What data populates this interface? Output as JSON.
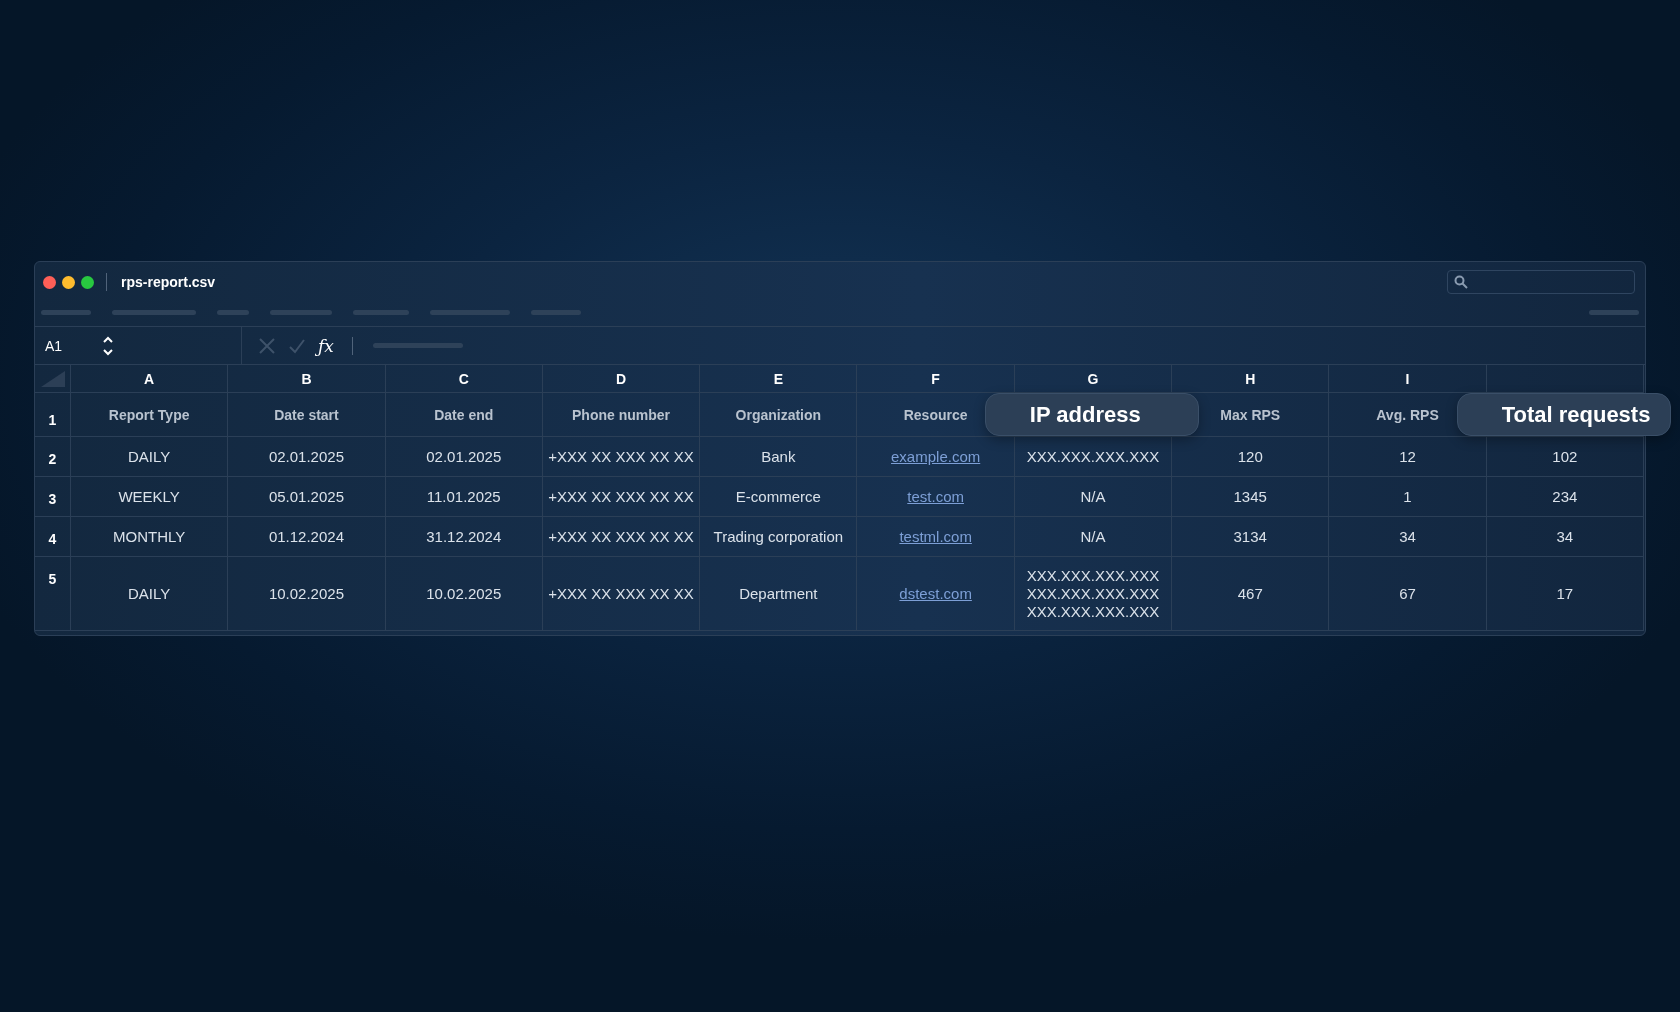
{
  "window": {
    "title": "rps-report.csv"
  },
  "formula_bar": {
    "cell_ref": "A1",
    "formula_symbol": "ƒx"
  },
  "header_row_number": "1",
  "columns": [
    {
      "letter": "A",
      "header": "Report Type",
      "kind": "text",
      "highlighted": false
    },
    {
      "letter": "B",
      "header": "Date start",
      "kind": "text",
      "highlighted": false
    },
    {
      "letter": "C",
      "header": "Date end",
      "kind": "text",
      "highlighted": false
    },
    {
      "letter": "D",
      "header": "Phone number",
      "kind": "text",
      "highlighted": false
    },
    {
      "letter": "E",
      "header": "Organization",
      "kind": "text",
      "highlighted": false
    },
    {
      "letter": "F",
      "header": "Resource",
      "kind": "link",
      "highlighted": false
    },
    {
      "letter": "G",
      "header": "IP address",
      "kind": "text",
      "highlighted": true
    },
    {
      "letter": "H",
      "header": "Max RPS",
      "kind": "text",
      "highlighted": false
    },
    {
      "letter": "I",
      "header": "Avg. RPS",
      "kind": "text",
      "highlighted": false
    },
    {
      "header": "Total requests",
      "kind": "text",
      "highlighted": true
    }
  ],
  "rows": [
    {
      "number": "2",
      "cells": [
        "DAILY",
        "02.01.2025",
        "02.01.2025",
        "+XXX XX XXX XX XX",
        "Bank",
        "example.com",
        "XXX.XXX.XXX.XXX",
        "120",
        "12",
        "102"
      ]
    },
    {
      "number": "3",
      "cells": [
        "WEEKLY",
        "05.01.2025",
        "11.01.2025",
        "+XXX XX XXX XX XX",
        "E-commerce",
        "test.com",
        "N/A",
        "1345",
        "1",
        "234"
      ]
    },
    {
      "number": "4",
      "cells": [
        "MONTHLY",
        "01.12.2024",
        "31.12.2024",
        "+XXX XX XXX XX XX",
        "Trading corporation",
        "testml.com",
        "N/A",
        "3134",
        "34",
        "34"
      ]
    },
    {
      "number": "5",
      "cells": [
        "DAILY",
        "10.02.2025",
        "10.02.2025",
        "+XXX XX XXX XX XX",
        "Department",
        "dstest.com",
        "XXX.XXX.XXX.XXX\nXXX.XXX.XXX.XXX\nXXX.XXX.XXX.XXX",
        "467",
        "67",
        "17"
      ]
    }
  ]
}
